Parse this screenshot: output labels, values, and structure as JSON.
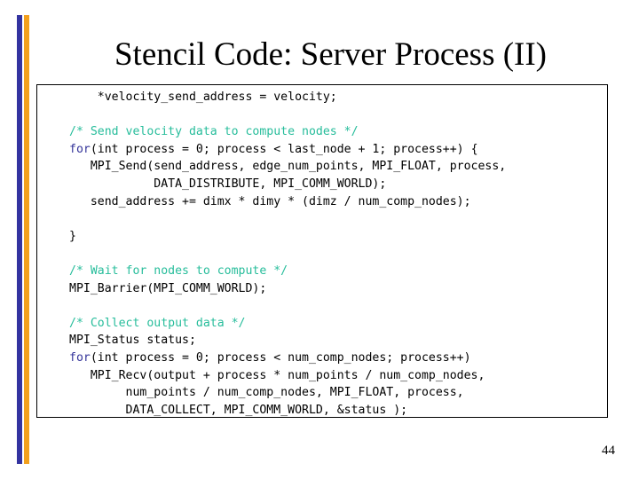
{
  "slide": {
    "title": "Stencil Code: Server Process (II)",
    "page_number": "44",
    "colors": {
      "bar_blue": "#3333A0",
      "bar_orange": "#F2A01D",
      "comment": "#27BD9B",
      "keyword": "#333399",
      "text": "#000000",
      "background": "#ffffff",
      "box_border": "#000000"
    }
  },
  "code": {
    "lines": [
      {
        "indent": 36,
        "segments": [
          {
            "text": "    *velocity_send_address = velocity;",
            "style": "plain"
          }
        ]
      },
      {
        "indent": 36,
        "segments": [
          {
            "text": "",
            "style": "plain"
          }
        ]
      },
      {
        "indent": 36,
        "segments": [
          {
            "text": "/* Send velocity data to compute nodes */",
            "style": "comment"
          }
        ]
      },
      {
        "indent": 36,
        "segments": [
          {
            "text": "for",
            "style": "keyword"
          },
          {
            "text": "(int process = 0; process < last_node + 1; process++) {",
            "style": "plain"
          }
        ]
      },
      {
        "indent": 36,
        "segments": [
          {
            "text": "   MPI_Send(send_address, edge_num_points, MPI_FLOAT, process,",
            "style": "plain"
          }
        ]
      },
      {
        "indent": 36,
        "segments": [
          {
            "text": "            DATA_DISTRIBUTE, MPI_COMM_WORLD);",
            "style": "plain"
          }
        ]
      },
      {
        "indent": 36,
        "segments": [
          {
            "text": "   send_address += dimx * dimy * (dimz / num_comp_nodes);",
            "style": "plain"
          }
        ]
      },
      {
        "indent": 36,
        "segments": [
          {
            "text": "",
            "style": "plain"
          }
        ]
      },
      {
        "indent": 36,
        "segments": [
          {
            "text": "}",
            "style": "plain"
          }
        ]
      },
      {
        "indent": 36,
        "segments": [
          {
            "text": "",
            "style": "plain"
          }
        ]
      },
      {
        "indent": 36,
        "segments": [
          {
            "text": "/* Wait for nodes to compute */",
            "style": "comment"
          }
        ]
      },
      {
        "indent": 36,
        "segments": [
          {
            "text": "MPI_Barrier(MPI_COMM_WORLD);",
            "style": "plain"
          }
        ]
      },
      {
        "indent": 36,
        "segments": [
          {
            "text": "",
            "style": "plain"
          }
        ]
      },
      {
        "indent": 36,
        "segments": [
          {
            "text": "/* Collect output data */",
            "style": "comment"
          }
        ]
      },
      {
        "indent": 36,
        "segments": [
          {
            "text": "MPI_Status status;",
            "style": "plain"
          }
        ]
      },
      {
        "indent": 36,
        "segments": [
          {
            "text": "for",
            "style": "keyword"
          },
          {
            "text": "(int process = 0; process < num_comp_nodes; process++)",
            "style": "plain"
          }
        ]
      },
      {
        "indent": 36,
        "segments": [
          {
            "text": "   MPI_Recv(output + process * num_points / num_comp_nodes,",
            "style": "plain"
          }
        ]
      },
      {
        "indent": 36,
        "segments": [
          {
            "text": "        num_points / num_comp_nodes, MPI_FLOAT, process,",
            "style": "plain"
          }
        ]
      },
      {
        "indent": 36,
        "segments": [
          {
            "text": "        DATA_COLLECT, MPI_COMM_WORLD, &status );",
            "style": "plain"
          }
        ]
      },
      {
        "indent": 36,
        "segments": [
          {
            "text": "",
            "style": "plain"
          }
        ]
      },
      {
        "indent": 36,
        "segments": [
          {
            "text": "}",
            "style": "plain"
          }
        ]
      }
    ]
  }
}
